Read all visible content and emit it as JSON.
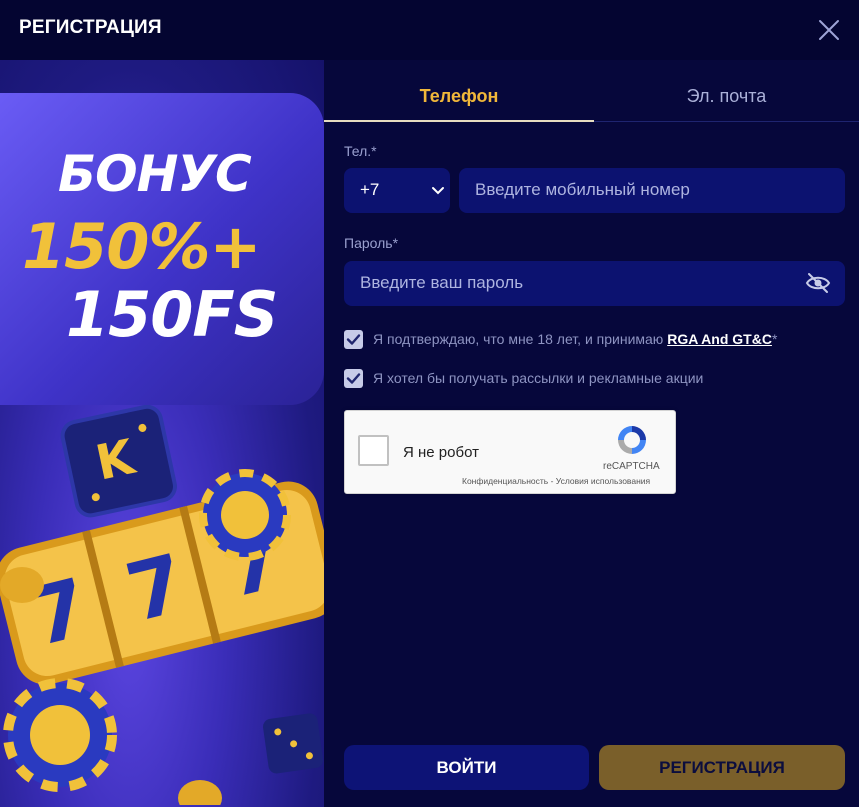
{
  "header": {
    "title": "РЕГИСТРАЦИЯ",
    "close_icon": "close-icon"
  },
  "promo": {
    "line1": "БОНУС",
    "line2": "150%+",
    "line3": "150FS"
  },
  "tabs": [
    {
      "label": "Телефон",
      "active": true
    },
    {
      "label": "Эл. почта",
      "active": false
    }
  ],
  "form": {
    "phone_label": "Тел.*",
    "country_code": "+7",
    "phone_placeholder": "Введите мобильный номер",
    "password_label": "Пароль*",
    "password_placeholder": "Введите ваш пароль",
    "terms_text": "Я подтверждаю, что мне 18 лет, и принимаю ",
    "terms_link": "RGA And GT&C",
    "terms_asterisk": "*",
    "newsletter_text": "Я хотел бы получать рассылки и рекламные акции",
    "terms_checked": true,
    "newsletter_checked": true
  },
  "captcha": {
    "label": "Я не робот",
    "brand": "reCAPTCHA",
    "links": "Конфиденциальность - Условия использования"
  },
  "buttons": {
    "login": "ВОЙТИ",
    "register": "РЕГИСТРАЦИЯ"
  },
  "colors": {
    "accent": "#f0b73a",
    "background": "#06073b",
    "field": "#0c1270",
    "register_button": "#7a5f2a"
  }
}
